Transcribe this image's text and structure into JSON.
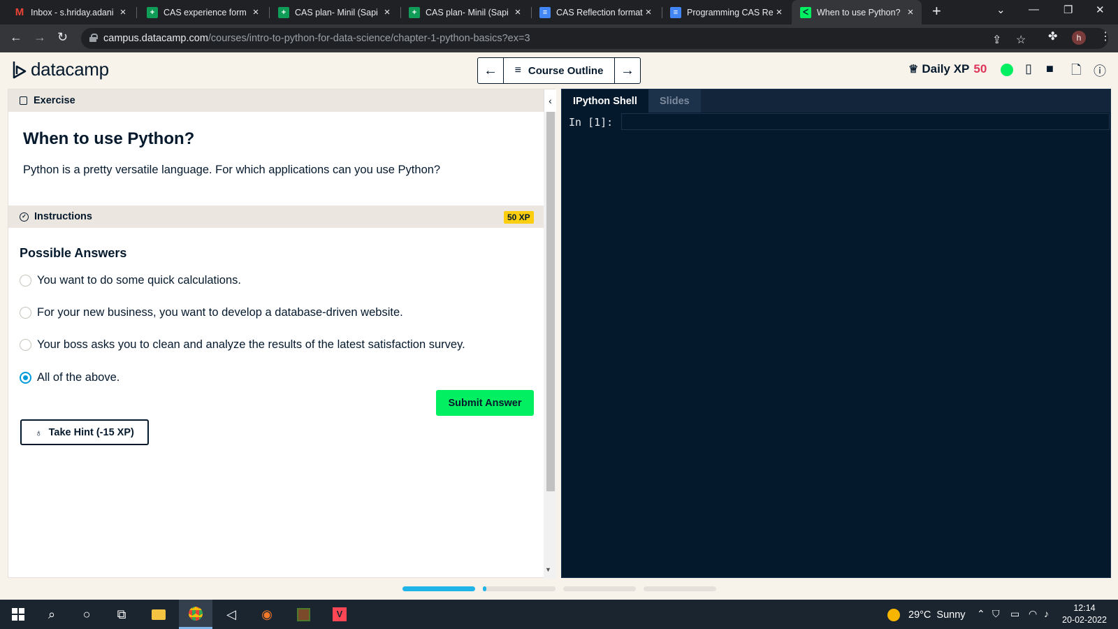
{
  "browser": {
    "tabs": [
      {
        "title": "Inbox - s.hriday.adani",
        "icon": "gmail-icon"
      },
      {
        "title": "CAS experience form",
        "icon": "sheets-icon"
      },
      {
        "title": "CAS plan- Minil (Sapi",
        "icon": "sheets-icon"
      },
      {
        "title": "CAS plan- Minil (Sapi",
        "icon": "sheets-icon"
      },
      {
        "title": "CAS Reflection format",
        "icon": "docs-icon"
      },
      {
        "title": "Programming CAS Re",
        "icon": "docs-icon"
      },
      {
        "title": "When to use Python?",
        "icon": "datacamp-icon"
      }
    ],
    "url_host": "campus.datacamp.com",
    "url_path": "/courses/intro-to-python-for-data-science/chapter-1-python-basics?ex=3",
    "profile_initial": "h"
  },
  "header": {
    "logo_text": "datacamp",
    "course_outline_label": "Course Outline",
    "daily_xp_label": "Daily XP",
    "daily_xp_value": "50"
  },
  "exercise": {
    "panel_label": "Exercise",
    "title": "When to use Python?",
    "description": "Python is a pretty versatile language. For which applications can you use Python?",
    "instructions_label": "Instructions",
    "xp_badge": "50 XP",
    "answers_heading": "Possible Answers",
    "answers": [
      "You want to do some quick calculations.",
      "For your new business, you want to develop a database-driven website.",
      "Your boss asks you to clean and analyze the results of the latest satisfaction survey.",
      "All of the above."
    ],
    "selected_index": 3,
    "submit_label": "Submit Answer",
    "hint_label": "Take Hint (-15 XP)"
  },
  "shell": {
    "tabs": [
      "IPython Shell",
      "Slides"
    ],
    "active_tab": "IPython Shell",
    "prompt": "In [1]:"
  },
  "progress": {
    "segments": [
      1.0,
      0.05,
      0,
      0
    ]
  },
  "taskbar": {
    "weather_temp": "29°C",
    "weather_text": "Sunny",
    "time": "12:14",
    "date": "20-02-2022"
  },
  "colors": {
    "brand_green": "#03ef62",
    "navy": "#05192d",
    "xp_pink": "#dd3459",
    "badge_yellow": "#fcce0d",
    "radio_blue": "#009bd8"
  }
}
